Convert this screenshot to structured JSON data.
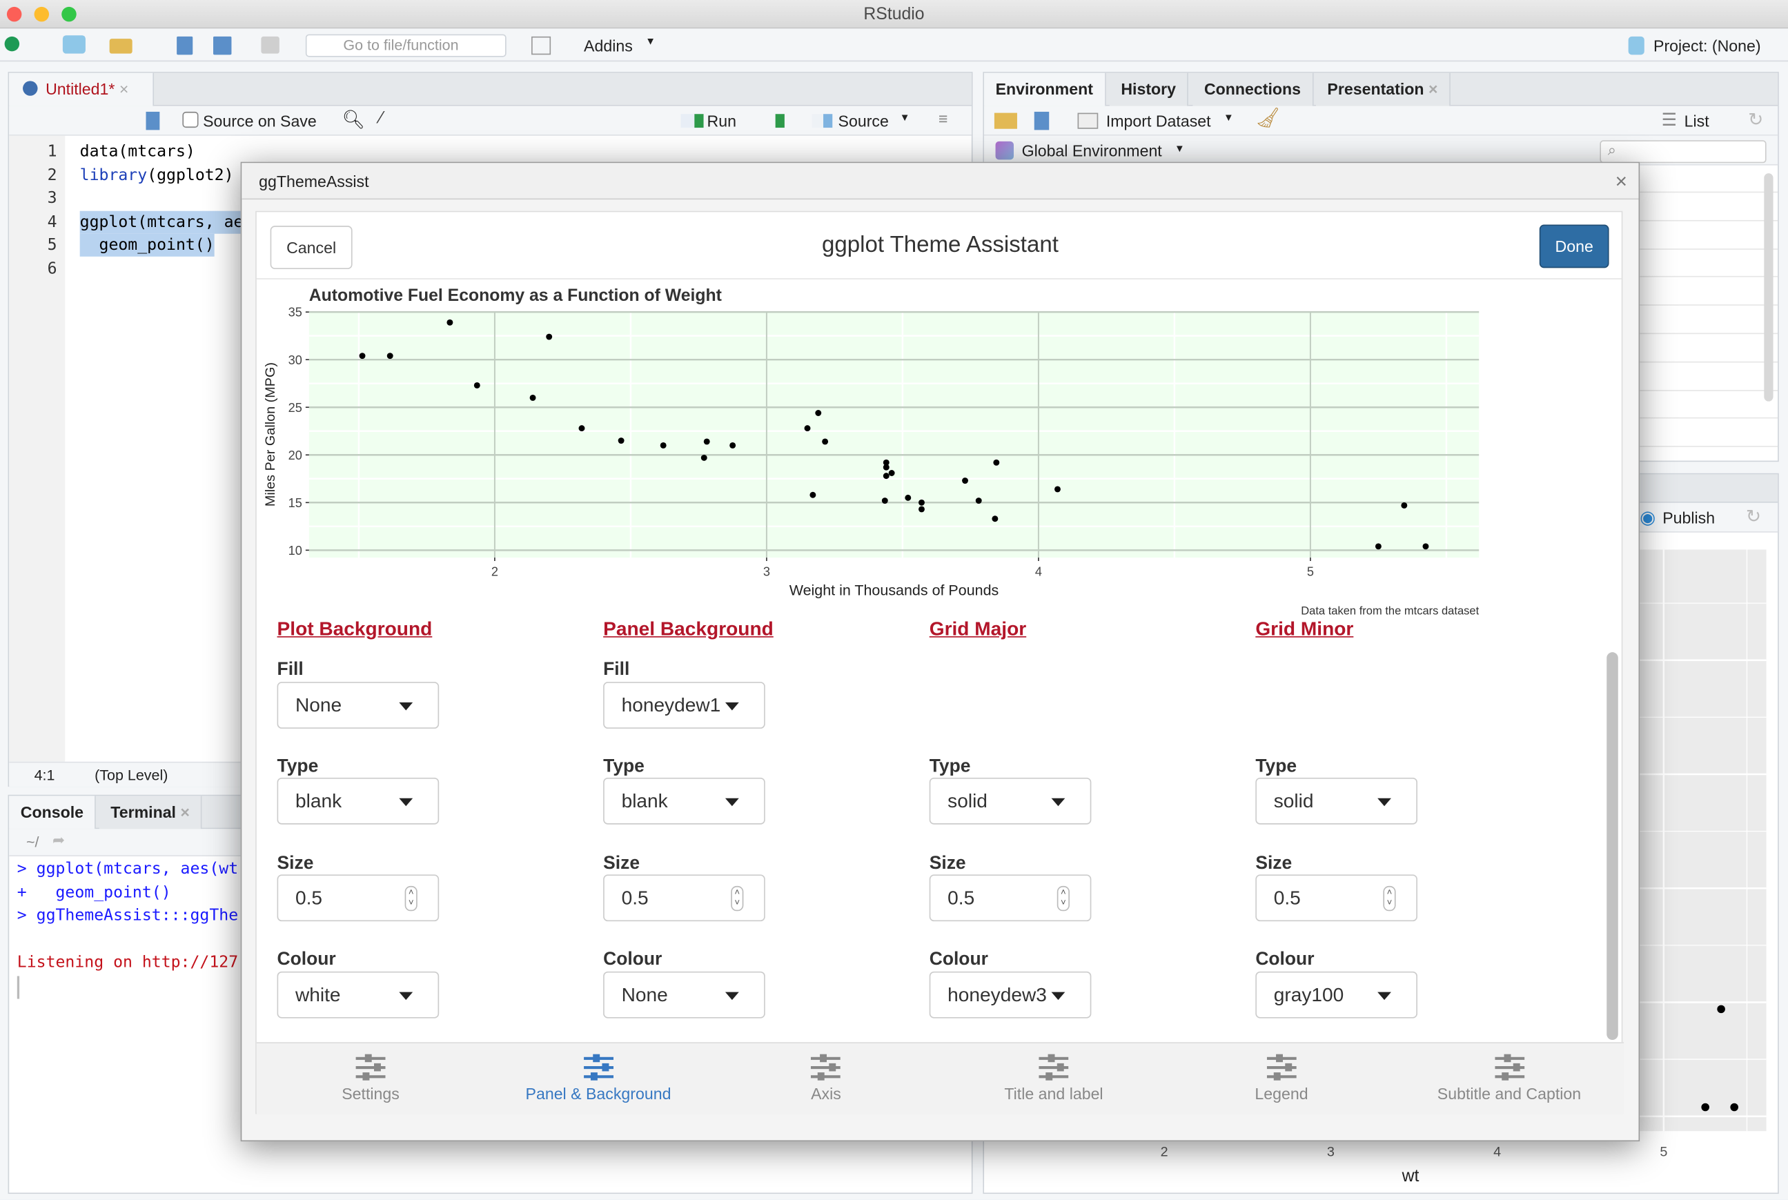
{
  "window": {
    "title": "RStudio"
  },
  "toolbar": {
    "goto_placeholder": "Go to file/function",
    "addins": "Addins",
    "project": "Project: (None)"
  },
  "source": {
    "tab": "Untitled1*",
    "source_on_save": "Source on Save",
    "run": "Run",
    "source": "Source",
    "lines": [
      {
        "n": "1",
        "code": "data(mtcars)"
      },
      {
        "n": "2",
        "fn": "library",
        "code": "(ggplot2)"
      },
      {
        "n": "3",
        "code": ""
      },
      {
        "n": "4",
        "code": "ggplot(mtcars, ae"
      },
      {
        "n": "5",
        "code": "  geom_point()"
      },
      {
        "n": "6",
        "code": ""
      }
    ],
    "status_pos": "4:1",
    "status_scope": "(Top Level)"
  },
  "console": {
    "tabs": [
      "Console",
      "Terminal"
    ],
    "path": "~/",
    "lines": [
      {
        "text": "> ggplot(mtcars, aes(wt",
        "color": "#1a1aff"
      },
      {
        "text": "+   geom_point()",
        "color": "#1a1aff"
      },
      {
        "text": "> ggThemeAssist:::ggThe",
        "color": "#1a1aff"
      },
      {
        "text": "",
        "color": "#000"
      },
      {
        "text": "Listening on http://127",
        "color": "#c4121b"
      }
    ]
  },
  "environment": {
    "tabs": [
      "Environment",
      "History",
      "Connections",
      "Presentation"
    ],
    "import_dataset": "Import Dataset",
    "list": "List",
    "global_env": "Global Environment"
  },
  "plots": {
    "publish": "Publish",
    "x_ticks": [
      "2",
      "3",
      "4",
      "5"
    ],
    "xlabel": "wt"
  },
  "dialog": {
    "window_title": "ggThemeAssist",
    "title": "ggplot Theme Assistant",
    "cancel": "Cancel",
    "done": "Done",
    "sections": [
      {
        "title": "Plot Background",
        "fill_label": "Fill",
        "fill": "None",
        "type_label": "Type",
        "type": "blank",
        "size_label": "Size",
        "size": "0.5",
        "colour_label": "Colour",
        "colour": "white"
      },
      {
        "title": "Panel Background",
        "fill_label": "Fill",
        "fill": "honeydew1",
        "type_label": "Type",
        "type": "blank",
        "size_label": "Size",
        "size": "0.5",
        "colour_label": "Colour",
        "colour": "None"
      },
      {
        "title": "Grid Major",
        "type_label": "Type",
        "type": "solid",
        "size_label": "Size",
        "size": "0.5",
        "colour_label": "Colour",
        "colour": "honeydew3"
      },
      {
        "title": "Grid Minor",
        "type_label": "Type",
        "type": "solid",
        "size_label": "Size",
        "size": "0.5",
        "colour_label": "Colour",
        "colour": "gray100"
      }
    ],
    "bottom_tabs": [
      "Settings",
      "Panel & Background",
      "Axis",
      "Title and label",
      "Legend",
      "Subtitle and Caption"
    ],
    "active_tab": "Panel & Background"
  },
  "colors": {
    "accent": "#3778c2",
    "section": "#b3162a",
    "done": "#2e6da4",
    "panel_fill": "#f0fff0",
    "grid_major": "#c1cdc1",
    "grid_minor": "#ffffff"
  },
  "chart_data": {
    "type": "scatter",
    "title": "Automotive Fuel Economy as a Function of Weight",
    "xlabel": "Weight in Thousands of Pounds",
    "ylabel": "Miles Per Gallon (MPG)",
    "caption": "Data taken from the mtcars dataset",
    "xlim": [
      1.317,
      5.62
    ],
    "ylim": [
      9.225,
      35.075
    ],
    "x_ticks": [
      "2",
      "3",
      "4",
      "5"
    ],
    "y_ticks": [
      "10",
      "15",
      "20",
      "25",
      "30",
      "35"
    ],
    "grid": true,
    "x": [
      2.62,
      2.875,
      2.32,
      3.215,
      3.44,
      3.46,
      3.57,
      3.19,
      3.15,
      3.44,
      3.44,
      4.07,
      3.73,
      3.78,
      5.25,
      5.424,
      5.345,
      2.2,
      1.615,
      1.835,
      2.465,
      3.52,
      3.435,
      3.84,
      3.845,
      1.935,
      2.14,
      1.513,
      3.17,
      2.77,
      3.57,
      2.78
    ],
    "y": [
      21,
      21,
      22.8,
      21.4,
      18.7,
      18.1,
      14.3,
      24.4,
      22.8,
      19.2,
      17.8,
      16.4,
      17.3,
      15.2,
      10.4,
      10.4,
      14.7,
      32.4,
      30.4,
      33.9,
      21.5,
      15.5,
      15.2,
      13.3,
      19.2,
      27.3,
      26,
      30.4,
      15.8,
      19.7,
      15,
      21.4
    ]
  }
}
